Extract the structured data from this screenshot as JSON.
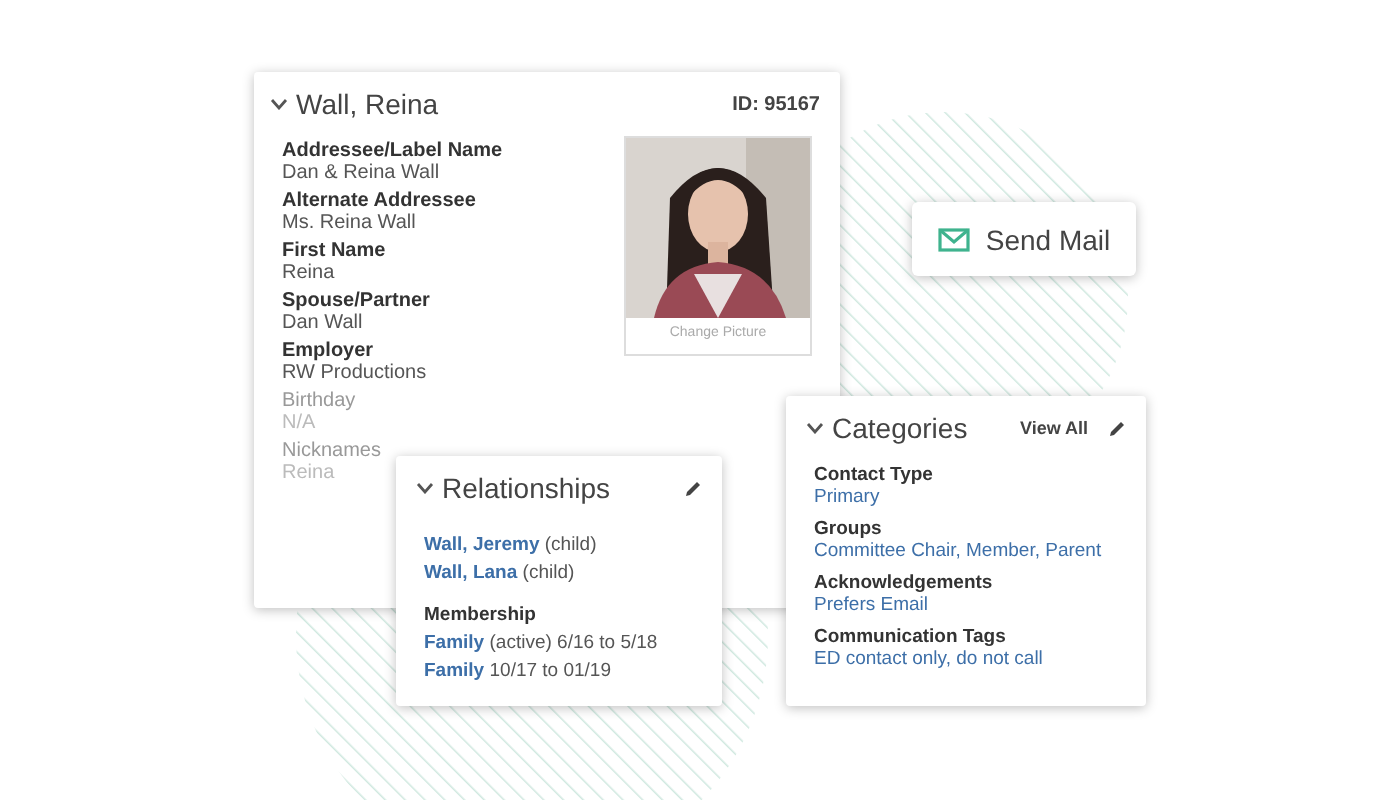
{
  "contact_card": {
    "title": "Wall, Reina",
    "id": "ID: 95167",
    "photo": {
      "kind": "picture",
      "caption": "Change Picture"
    },
    "fields": [
      {
        "label": "Addressee/Label Name",
        "value": "Dan & Reina Wall",
        "faded": false
      },
      {
        "label": "Alternate Addressee",
        "value": "Ms. Reina Wall",
        "faded": false
      },
      {
        "label": "First Name",
        "value": "Reina",
        "faded": false
      },
      {
        "label": "Spouse/Partner",
        "value": "Dan Wall",
        "faded": false
      },
      {
        "label": "Employer",
        "value": "RW Productions",
        "faded": false
      },
      {
        "label": "Birthday",
        "value": "N/A",
        "faded": true
      },
      {
        "label": "Nicknames",
        "value": "Reina",
        "faded": true
      }
    ]
  },
  "send_mail_button": {
    "label": "Send Mail"
  },
  "relationships": {
    "title": "Relationships",
    "people": [
      {
        "name": "Wall, Jeremy",
        "note": "(child)"
      },
      {
        "name": "Wall, Lana",
        "note": "(child)"
      }
    ],
    "membership_label": "Membership",
    "memberships": [
      {
        "type": "Family",
        "note": "(active) 6/16 to 5/18"
      },
      {
        "type": "Family",
        "note": "10/17 to 01/19"
      }
    ]
  },
  "categories": {
    "title": "Categories",
    "view_all": "View All",
    "items": [
      {
        "label": "Contact Type",
        "value": "Primary"
      },
      {
        "label": "Groups",
        "value": "Committee Chair, Member, Parent"
      },
      {
        "label": "Acknowledgements",
        "value": "Prefers Email"
      },
      {
        "label": "Communication Tags",
        "value": "ED contact only, do not call"
      }
    ]
  }
}
